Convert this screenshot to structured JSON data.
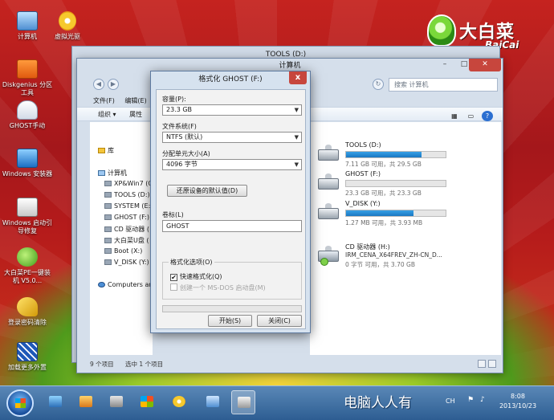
{
  "desktop": {
    "icons": [
      {
        "label": "计算机",
        "icon": "computer-icon"
      },
      {
        "label": "虚拟光驱",
        "icon": "virtual-cd-icon"
      },
      {
        "label": "Diskgenius 分区工具",
        "icon": "diskgenius-icon"
      },
      {
        "label": "GHOST手动",
        "icon": "ghost-icon"
      },
      {
        "label": "Windows 安装器",
        "icon": "windows-installer-icon"
      },
      {
        "label": "Windows 启动引导修复",
        "icon": "boot-repair-icon"
      },
      {
        "label": "大白菜PE一键装机 V5.0...",
        "icon": "dabaicai-install-icon"
      },
      {
        "label": "登录密码清除",
        "icon": "password-clear-icon"
      },
      {
        "label": "加载更多外置",
        "icon": "load-more-icon"
      }
    ]
  },
  "logo": {
    "cn": "大白菜",
    "en": "BaiCai"
  },
  "back_window": {
    "title": "TOOLS (D:)"
  },
  "explorer": {
    "title": "计算机",
    "search_placeholder": "搜索 计算机",
    "menu": {
      "file": "文件(F)",
      "edit": "编辑(E)",
      "view": "文"
    },
    "toolbar": {
      "organize": "组织 ▾",
      "properties": "属性"
    },
    "nav": {
      "library": "库",
      "computer": "计算机",
      "drives": [
        "XP&Win7 (C",
        "TOOLS (D:)",
        "SYSTEM (E:",
        "GHOST (F:)",
        "CD 驱动器 (",
        "大白菜U盘 (",
        "Boot (X:)",
        "V_DISK (Y:)"
      ],
      "network": "Computers and"
    },
    "drives": [
      {
        "name": "TOOLS (D:)",
        "info": "7.11 GB 可用，共 29.5 GB",
        "used": 0.76
      },
      {
        "name": "GHOST (F:)",
        "info": "23.3 GB 可用，共 23.3 GB",
        "used": 0.0
      },
      {
        "name": "V_DISK (Y:)",
        "info": "1.27 MB 可用，共 3.93 MB",
        "used": 0.68
      }
    ],
    "cd_drive": {
      "name": "CD 驱动器 (H:)",
      "label": "IRM_CENA_X64FREV_ZH-CN_D...",
      "info": "0 字节 可用，共 3.70 GB"
    },
    "status": {
      "items": "9 个项目",
      "selected": "选中 1 个项目"
    }
  },
  "format_dialog": {
    "title": "格式化 GHOST (F:)",
    "close": "x",
    "capacity_label": "容量(P):",
    "capacity_value": "23.3 GB",
    "filesystem_label": "文件系统(F)",
    "filesystem_value": "NTFS (默认)",
    "alloc_label": "分配单元大小(A)",
    "alloc_value": "4096 字节",
    "restore_button": "还原设备的默认值(D)",
    "volume_label": "卷标(L)",
    "volume_value": "GHOST",
    "options_title": "格式化选项(O)",
    "quick_format": "快速格式化(Q)",
    "quick_format_checked": true,
    "msdos_disk": "创建一个 MS-DOS 启动盘(M)",
    "msdos_disk_checked": false,
    "progress": 0.0,
    "start_button": "开始(S)",
    "close_button": "关闭(C)"
  },
  "taskbar": {
    "brand": "电脑人人有",
    "input_indicator": "CH",
    "time": "8:08",
    "date": "2013/10/23"
  }
}
